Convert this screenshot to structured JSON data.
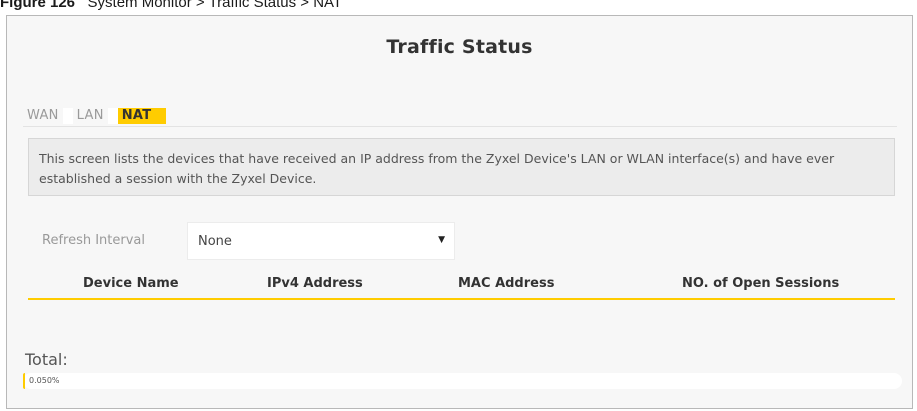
{
  "caption": {
    "figure_number": "Figure 126",
    "text": "System Monitor > Traffic Status > NAT"
  },
  "panel": {
    "title": "Traffic Status"
  },
  "tabs": [
    {
      "label": "WAN",
      "active": false
    },
    {
      "label": "LAN",
      "active": false
    },
    {
      "label": "NAT",
      "active": true
    }
  ],
  "notice": {
    "text": "This screen lists the devices that have received an IP address from the Zyxel Device's LAN or WLAN interface(s) and have ever established a session with the Zyxel Device."
  },
  "refresh": {
    "label": "Refresh Interval",
    "selected": "None",
    "dropdown_icon": "caret-down-icon"
  },
  "table": {
    "columns": [
      "Device Name",
      "IPv4 Address",
      "MAC Address",
      "NO. of Open Sessions"
    ],
    "rows": []
  },
  "total": {
    "label": "Total:",
    "progress_text": "0.050%",
    "progress_percent": 0.05
  },
  "colors": {
    "accent": "#ffcc00",
    "frame_bg": "#f7f7f7",
    "notice_bg": "#ececec"
  }
}
